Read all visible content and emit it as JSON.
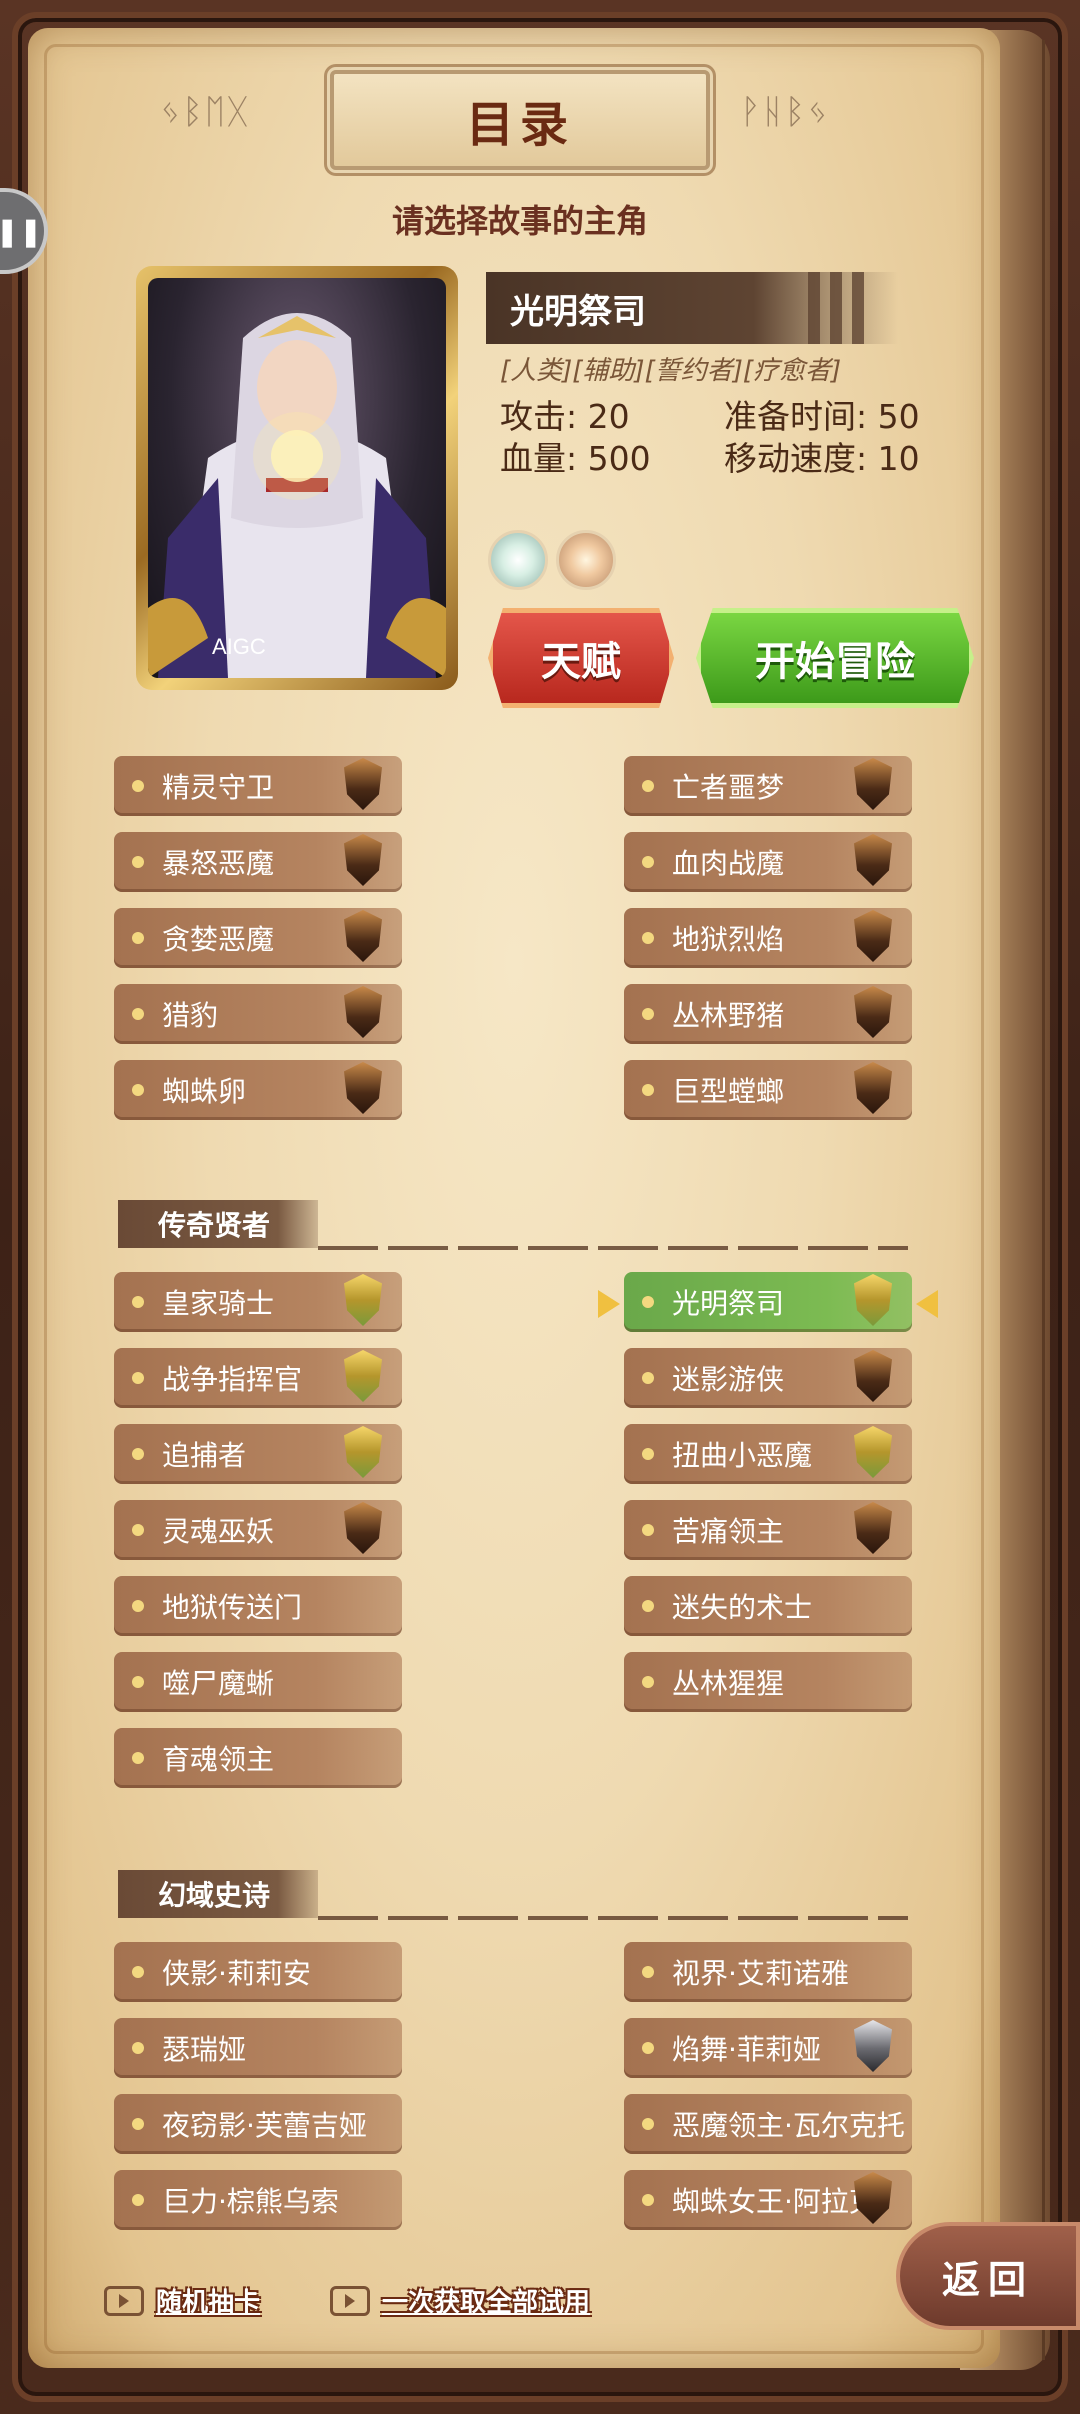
{
  "header": {
    "title": "目录",
    "rune_left": "ᛃᛒᛖᚷ",
    "rune_right": "ᚹᚺᛒᛃ",
    "subtitle": "请选择故事的主角"
  },
  "portrait": {
    "watermark": "AIGC"
  },
  "hero": {
    "name": "光明祭司",
    "tags": "[人类][辅助][誓约者][疗愈者]",
    "attack": "攻击: 20",
    "prep_time": "准备时间: 50",
    "hp": "血量: 500",
    "move_speed": "移动速度: 10"
  },
  "buttons": {
    "talent": "天赋",
    "start": "开始冒险",
    "return": "返回"
  },
  "list_top": [
    "精灵守卫",
    "亡者噩梦",
    "暴怒恶魔",
    "血肉战魔",
    "贪婪恶魔",
    "地狱烈焰",
    "猎豹",
    "丛林野猪",
    "蜘蛛卵",
    "巨型螳螂"
  ],
  "section_legend": "传奇贤者",
  "list_legend": [
    "皇家骑士",
    "光明祭司",
    "战争指挥官",
    "迷影游侠",
    "追捕者",
    "扭曲小恶魔",
    "灵魂巫妖",
    "苦痛领主",
    "地狱传送门",
    "迷失的术士",
    "噬尸魔蜥",
    "丛林猩猩",
    "育魂领主"
  ],
  "section_fantasy": "幻域史诗",
  "list_fantasy": [
    "侠影·莉莉安",
    "视界·艾莉诺雅",
    "瑟瑞娅",
    "焰舞·菲莉娅",
    "夜窃影·芙蕾吉娅",
    "恶魔领主·瓦尔克托",
    "巨力·棕熊乌索",
    "蜘蛛女王·阿拉克"
  ],
  "bottom": {
    "random_draw": "随机抽卡",
    "get_all_trial": "一次获取全部试用"
  },
  "colors": {
    "parchment": "#efdab1",
    "item_bg": "#b58460",
    "selected": "#7cbb52",
    "talent": "#d2392c",
    "start": "#5cb82c"
  }
}
